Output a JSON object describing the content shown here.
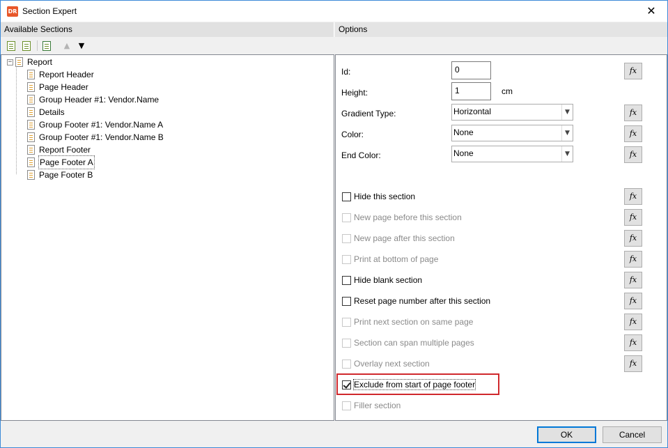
{
  "window": {
    "title": "Section Expert",
    "app_icon_text": "DR"
  },
  "left_pane": {
    "header": "Available Sections",
    "toolbar": {
      "move_up_icon": "triangle-up",
      "move_down_icon": "triangle-down"
    },
    "tree": {
      "root": "Report",
      "items": [
        "Report Header",
        "Page Header",
        "Group Header #1: Vendor.Name",
        "Details",
        "Group Footer #1: Vendor.Name A",
        "Group Footer #1: Vendor.Name B",
        "Report Footer",
        "Page Footer A",
        "Page Footer B"
      ],
      "selected": "Page Footer A"
    }
  },
  "right_pane": {
    "header": "Options",
    "fields": {
      "id_label": "Id:",
      "id_value": "0",
      "height_label": "Height:",
      "height_value": "1",
      "height_unit": "cm",
      "gradient_label": "Gradient Type:",
      "gradient_value": "Horizontal",
      "color_label": "Color:",
      "color_value": "None",
      "end_color_label": "End Color:",
      "end_color_value": "None"
    },
    "fx_label": "fx",
    "options": [
      {
        "label": "Hide this section",
        "checked": false,
        "enabled": true
      },
      {
        "label": "New page before this section",
        "checked": false,
        "enabled": false
      },
      {
        "label": "New page after this section",
        "checked": false,
        "enabled": false
      },
      {
        "label": "Print at bottom of page",
        "checked": false,
        "enabled": false
      },
      {
        "label": "Hide blank section",
        "checked": false,
        "enabled": true
      },
      {
        "label": "Reset page number after this section",
        "checked": false,
        "enabled": true
      },
      {
        "label": "Print next section on same page",
        "checked": false,
        "enabled": false
      },
      {
        "label": "Section can span multiple pages",
        "checked": false,
        "enabled": false
      },
      {
        "label": "Overlay next section",
        "checked": false,
        "enabled": false
      },
      {
        "label": "Exclude from start of page footer",
        "checked": true,
        "enabled": true
      },
      {
        "label": "Filler section",
        "checked": false,
        "enabled": false
      }
    ]
  },
  "buttons": {
    "ok": "OK",
    "cancel": "Cancel"
  },
  "colors": {
    "highlight": "#d0282c",
    "default_button_border": "#0078d7",
    "app_icon": "#e8572a"
  }
}
